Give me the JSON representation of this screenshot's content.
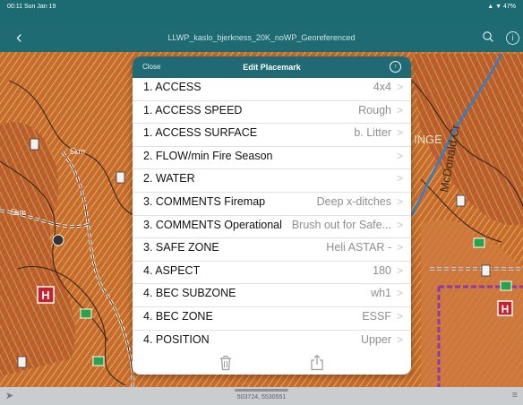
{
  "status_bar": {
    "time": "00:11  Sun Jan 19",
    "right": "▲ ▼ 47%"
  },
  "nav": {
    "back_icon": "chevron-left-icon",
    "title": "LLWP_kaslo_bjerkness_20K_noWP_Georeferenced",
    "search_icon": "search-icon",
    "info_icon": "info-icon"
  },
  "sheet": {
    "close_label": "Close",
    "title": "Edit Placemark",
    "gps_icon": "location-icon",
    "rows": [
      {
        "label": "1. ACCESS",
        "value": "4x4"
      },
      {
        "label": "1. ACCESS SPEED",
        "value": "Rough"
      },
      {
        "label": "1. ACCESS SURFACE",
        "value": "b. Litter"
      },
      {
        "label": "2. FLOW/min Fire Season",
        "value": ""
      },
      {
        "label": "2. WATER",
        "value": ""
      },
      {
        "label": "3. COMMENTS Firemap",
        "value": "Deep x-ditches"
      },
      {
        "label": "3. COMMENTS Operational",
        "value": "Brush out for Safe..."
      },
      {
        "label": "3. SAFE ZONE",
        "value": "Heli ASTAR -"
      },
      {
        "label": "4. ASPECT",
        "value": "180"
      },
      {
        "label": "4. BEC SUBZONE",
        "value": "wh1"
      },
      {
        "label": "4. BEC ZONE",
        "value": "ESSF"
      },
      {
        "label": "4. POSITION",
        "value": "Upper"
      }
    ],
    "chevron": ">",
    "trash_icon": "trash-icon",
    "share_icon": "share-icon"
  },
  "map": {
    "labels": [
      "McDonald Cr",
      "INGE",
      "5km",
      "5km"
    ]
  },
  "bottom_bar": {
    "coordinates": "503724, 5530551"
  },
  "colors": {
    "nav_bg": "#1e6b73",
    "sheet_header": "#1f6a74",
    "map_orange": "#d9733a",
    "map_yellow": "#c9b44a"
  }
}
